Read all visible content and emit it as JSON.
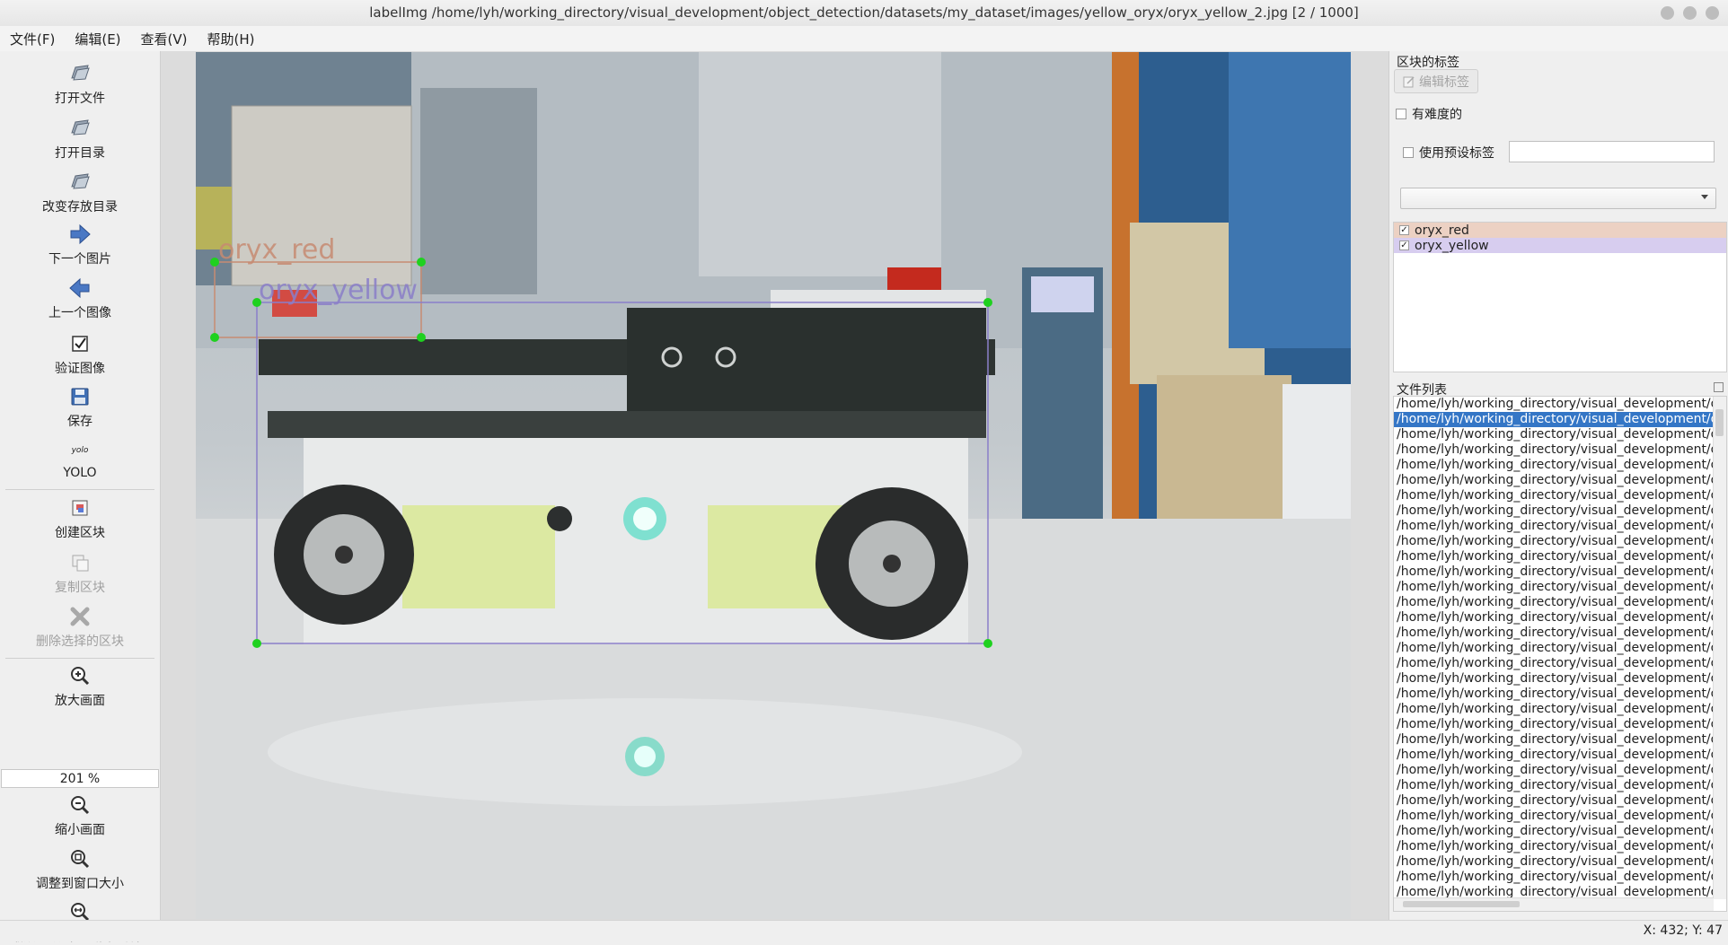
{
  "window": {
    "title": "labelImg /home/lyh/working_directory/visual_development/object_detection/datasets/my_dataset/images/yellow_oryx/oryx_yellow_2.jpg [2 / 1000]"
  },
  "menu": [
    "文件(F)",
    "编辑(E)",
    "查看(V)",
    "帮助(H)"
  ],
  "toolbar": {
    "open_file": "打开文件",
    "open_dir": "打开目录",
    "change_save_dir": "改变存放目录",
    "next_image": "下一个图片",
    "prev_image": "上一个图像",
    "verify_image": "验证图像",
    "save": "保存",
    "format_icon_text": "yolo",
    "format": "YOLO",
    "create_box": "创建区块",
    "duplicate_box": "复制区块",
    "delete_box": "删除选择的区块",
    "zoom_in": "放大画面",
    "zoom_value": "201 %",
    "zoom_out": "缩小画面",
    "fit_window": "调整到窗口大小",
    "fit_width": "缩放到跟当前画面一样宽"
  },
  "canvas": {
    "annotations": [
      {
        "label": "oryx_red",
        "color": "#c78b72"
      },
      {
        "label": "oryx_yellow",
        "color": "#8a7ec9"
      }
    ]
  },
  "right_panel": {
    "box_labels_title": "区块的标签",
    "edit_label_button": "编辑标签",
    "difficult_label": "有难度的",
    "use_default_label": "使用预设标签",
    "default_label_value": "",
    "label_items": [
      {
        "name": "oryx_red",
        "checked": "✓",
        "bg": "#ecd1c3"
      },
      {
        "name": "oryx_yellow",
        "checked": "✓",
        "bg": "#d7cdef"
      }
    ],
    "file_list_title": "文件列表",
    "file_entry_text": "/home/lyh/working_directory/visual_development/object_detection/datasets/my_dataset/images/yellow_oryx/oryx_yellow_",
    "selected_index": 1,
    "visible_file_rows": 33
  },
  "status": {
    "coords": "X: 432; Y: 47"
  }
}
